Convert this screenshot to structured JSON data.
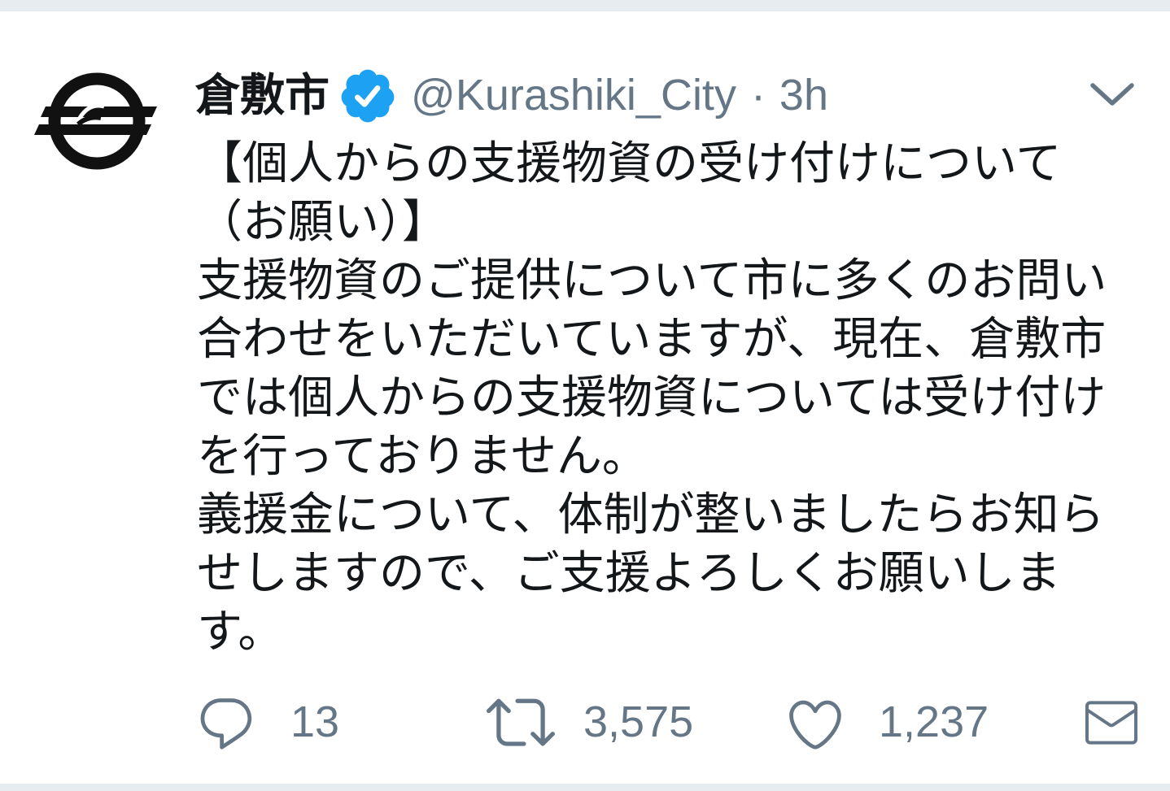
{
  "colors": {
    "text": "#14171a",
    "secondary": "#657786",
    "verified": "#1da1f2",
    "divider": "#e6ecf0",
    "background": "#ffffff"
  },
  "tweet": {
    "author": {
      "name": "倉敷市",
      "handle": "@Kurashiki_City",
      "avatar_icon": "kurashiki-city-emblem",
      "badge_icon": "verified-badge-icon"
    },
    "separator": "·",
    "timestamp": "3h",
    "menu_icon": "chevron-down-icon",
    "text_lines": [
      "【個人からの支援物資の受け付けについて",
      "（お願い）】",
      "支援物資のご提供について市に多くのお問い",
      "合わせをいただいていますが、現在、倉敷市",
      "では個人からの支援物資については受け付け",
      "を行っておりません。",
      "義援金について、体制が整いましたらお知ら",
      "せしますので、ご支援よろしくお願いしま",
      "す。"
    ],
    "actions": {
      "reply": {
        "icon": "reply-icon",
        "count": "13"
      },
      "retweet": {
        "icon": "retweet-icon",
        "count": "3,575"
      },
      "like": {
        "icon": "heart-icon",
        "count": "1,237"
      },
      "direct_message": {
        "icon": "envelope-icon"
      }
    }
  }
}
